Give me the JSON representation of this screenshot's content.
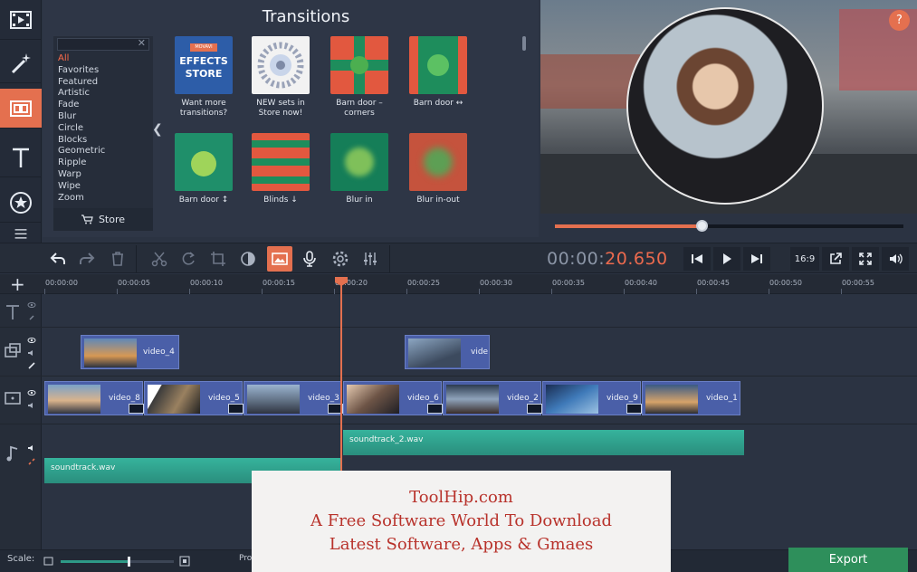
{
  "transitions": {
    "title": "Transitions",
    "categories": [
      "All",
      "Favorites",
      "Featured",
      "Artistic",
      "Fade",
      "Blur",
      "Circle",
      "Blocks",
      "Geometric",
      "Ripple",
      "Warp",
      "Wipe",
      "Zoom"
    ],
    "selected_category": "All",
    "store_label": "Store",
    "thumbs": [
      {
        "label": "Want more transitions?",
        "line1": "Want more",
        "line2": "transitions?",
        "badge_top": "MOVAVI",
        "badge_main1": "EFFECTS",
        "badge_main2": "STORE"
      },
      {
        "label": "NEW sets in Store now!",
        "line1": "NEW sets in",
        "line2": "Store now!"
      },
      {
        "label": "Barn door - corners",
        "line1": "Barn door –",
        "line2": "corners"
      },
      {
        "label": "Barn door ↔",
        "line1": "Barn door ↔",
        "line2": ""
      },
      {
        "label": "Barn door ↕",
        "line1": "Barn door ↕",
        "line2": ""
      },
      {
        "label": "Blinds ↓",
        "line1": "Blinds ↓",
        "line2": ""
      },
      {
        "label": "Blur in",
        "line1": "Blur in",
        "line2": ""
      },
      {
        "label": "Blur in-out",
        "line1": "Blur in-out",
        "line2": ""
      }
    ]
  },
  "preview": {
    "help": "?",
    "progress": 0.42
  },
  "toolbar": {
    "timecode_dim": "00:00:",
    "timecode_bright": "20.650",
    "aspect": "16:9"
  },
  "ruler": {
    "ticks": [
      "00:00:00",
      "00:00:05",
      "00:00:10",
      "00:00:15",
      "00:00:20",
      "00:00:25",
      "00:00:30",
      "00:00:35",
      "00:00:40",
      "00:00:45",
      "00:00:50",
      "00:00:55"
    ],
    "add": "+"
  },
  "clips": {
    "overlay": [
      {
        "name": "video_4"
      },
      {
        "name": "vide"
      }
    ],
    "main": [
      {
        "name": "video_8"
      },
      {
        "name": "video_5"
      },
      {
        "name": "video_3"
      },
      {
        "name": "video_6"
      },
      {
        "name": "video_2"
      },
      {
        "name": "video_9"
      },
      {
        "name": "video_1"
      }
    ]
  },
  "audio": {
    "track1": "soundtrack_2.wav",
    "track2": "soundtrack.wav"
  },
  "bottom": {
    "scale_label": "Scale:",
    "scale_value": 0.6,
    "prog_label": "Pro",
    "export_label": "Export"
  },
  "watermark": {
    "line1": "ToolHip.com",
    "line2": "A Free Software World To Download",
    "line3": "Latest Software, Apps & Gmaes"
  },
  "colors": {
    "accent": "#e4704f",
    "clip": "#4a5fa8",
    "audio": "#2fa18e",
    "export": "#2e8f5b"
  }
}
